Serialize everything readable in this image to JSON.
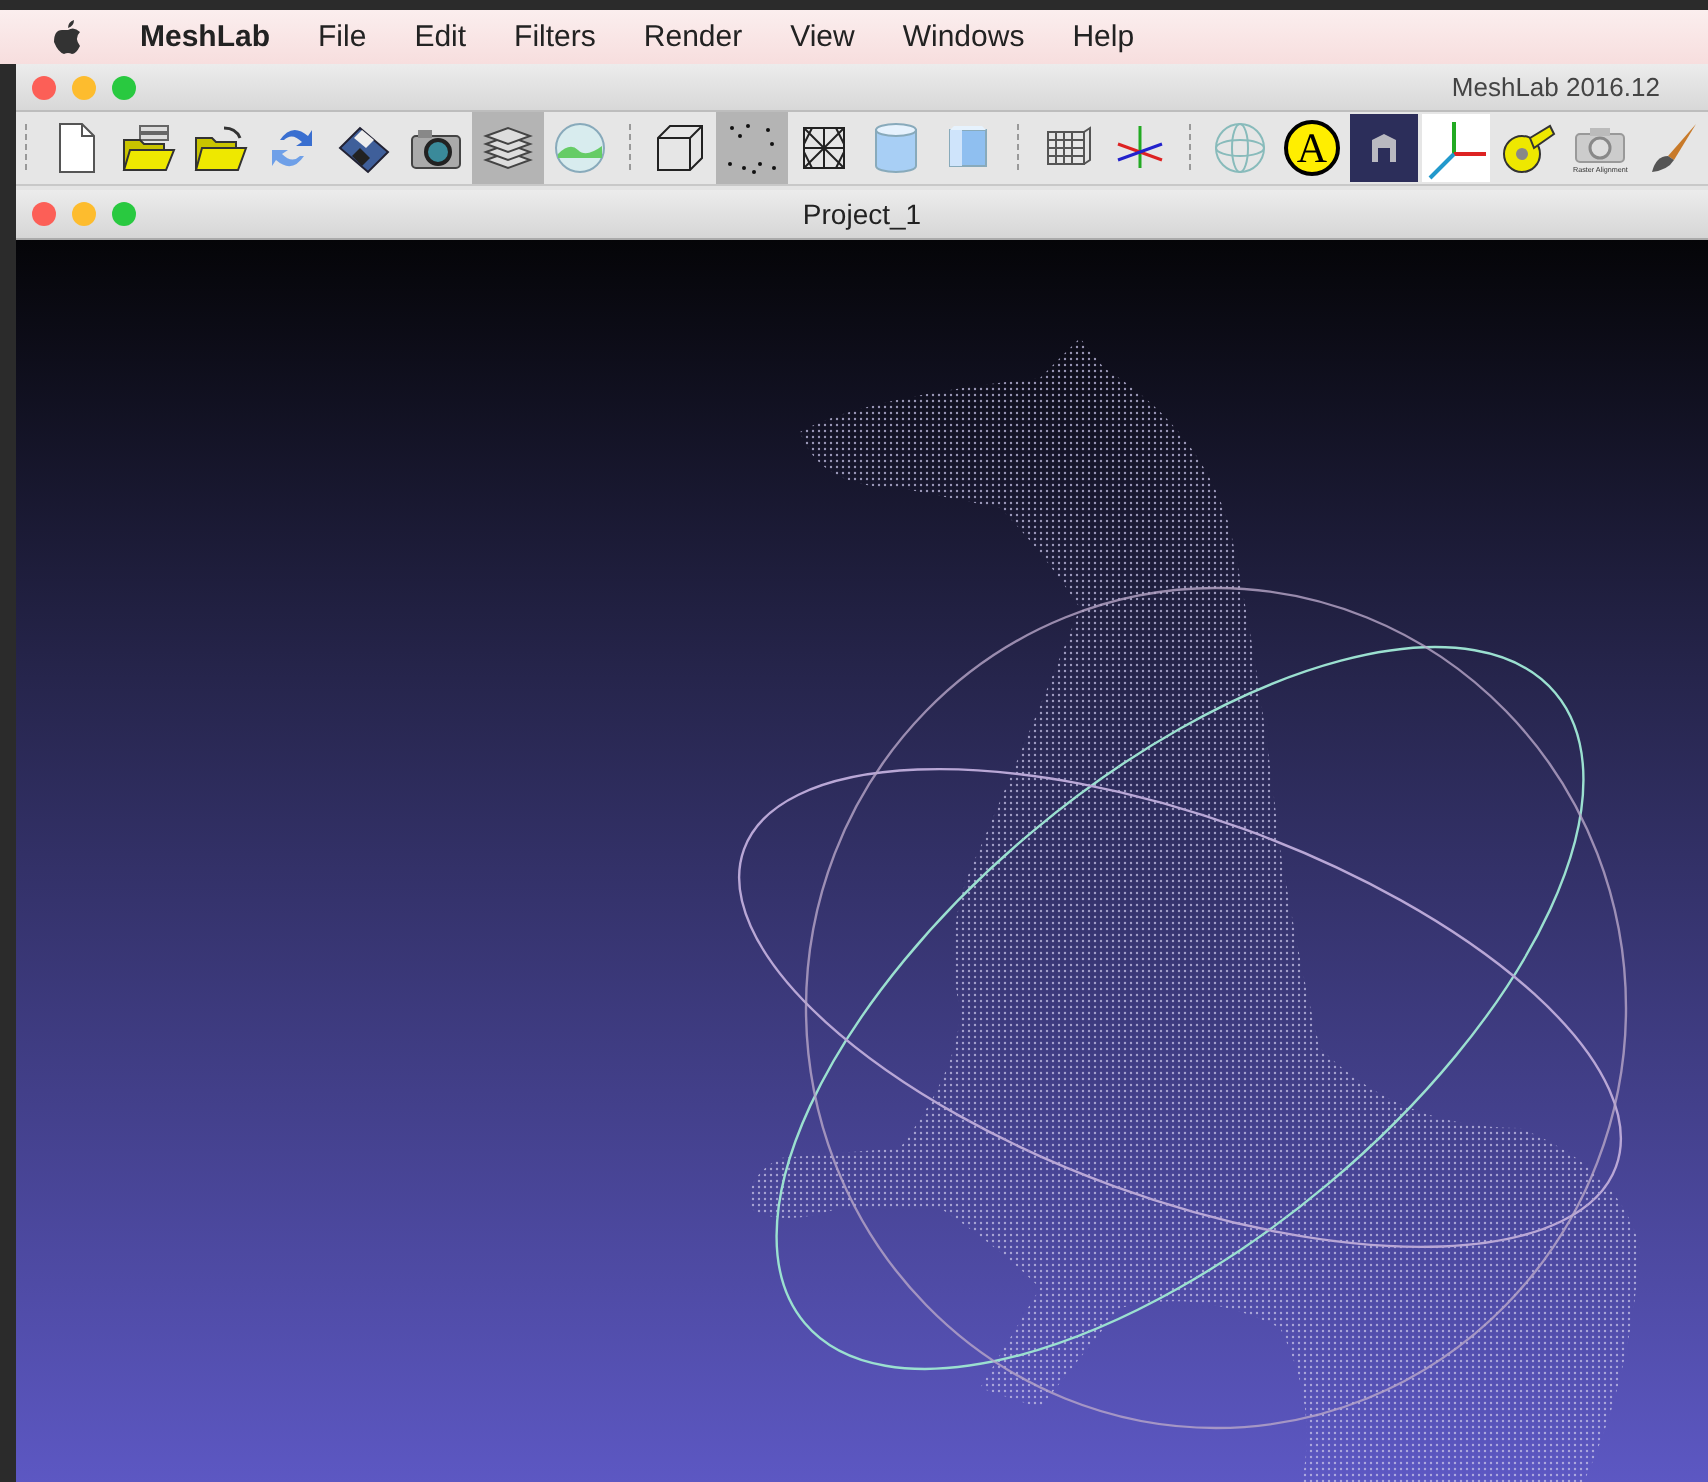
{
  "menu_bar": {
    "app_name": "MeshLab",
    "items": [
      "File",
      "Edit",
      "Filters",
      "Render",
      "View",
      "Windows",
      "Help"
    ]
  },
  "window": {
    "title": "MeshLab 2016.12"
  },
  "toolbar": [
    {
      "kind": "new",
      "selected": false
    },
    {
      "kind": "open-project",
      "selected": false
    },
    {
      "kind": "open",
      "selected": false
    },
    {
      "kind": "reload",
      "selected": false
    },
    {
      "kind": "save",
      "selected": false
    },
    {
      "kind": "snapshot",
      "selected": false
    },
    {
      "kind": "layers",
      "selected": true
    },
    {
      "kind": "texture",
      "selected": false
    },
    {
      "kind": "separator"
    },
    {
      "kind": "box",
      "selected": false
    },
    {
      "kind": "points",
      "selected": true
    },
    {
      "kind": "wireframe",
      "selected": false
    },
    {
      "kind": "flat",
      "selected": false
    },
    {
      "kind": "smooth",
      "selected": false
    },
    {
      "kind": "separator"
    },
    {
      "kind": "grid",
      "selected": false
    },
    {
      "kind": "axes",
      "selected": false
    },
    {
      "kind": "separator"
    },
    {
      "kind": "sphere",
      "selected": false
    },
    {
      "kind": "letter",
      "text": "A",
      "selected": false
    },
    {
      "kind": "arch",
      "selected": false
    },
    {
      "kind": "frame",
      "selected": false
    },
    {
      "kind": "measure",
      "selected": false
    },
    {
      "kind": "raster",
      "caption": "Raster Alignment",
      "selected": false
    },
    {
      "kind": "brush",
      "selected": false
    }
  ],
  "document": {
    "title": "Project_1"
  }
}
